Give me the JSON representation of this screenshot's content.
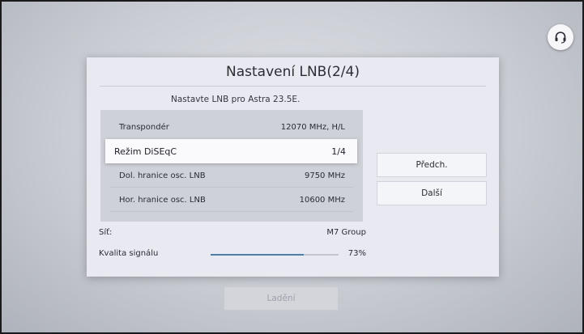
{
  "dialog": {
    "title": "Nastavení LNB(2/4)",
    "subtitle": "Nastavte LNB pro Astra 23.5E."
  },
  "settings": [
    {
      "label": "Transpondér",
      "value": "12070 MHz, H/L"
    },
    {
      "label": "Režim DiSEqC",
      "value": "1/4"
    },
    {
      "label": "Dol. hranice osc. LNB",
      "value": "9750 MHz"
    },
    {
      "label": "Hor. hranice osc. LNB",
      "value": "10600 MHz"
    }
  ],
  "partial_row_label": "...",
  "buttons": {
    "prev": "Předch.",
    "next": "Další",
    "tune": "Ladění"
  },
  "info": {
    "network_label": "Síť:",
    "network_value": "M7 Group",
    "signal_label": "Kvalita signálu",
    "signal_value": "73%",
    "signal_fraction": 0.73
  },
  "icons": {
    "help": "headset-icon"
  },
  "colors": {
    "signal_fill": "#4b7fa8"
  }
}
